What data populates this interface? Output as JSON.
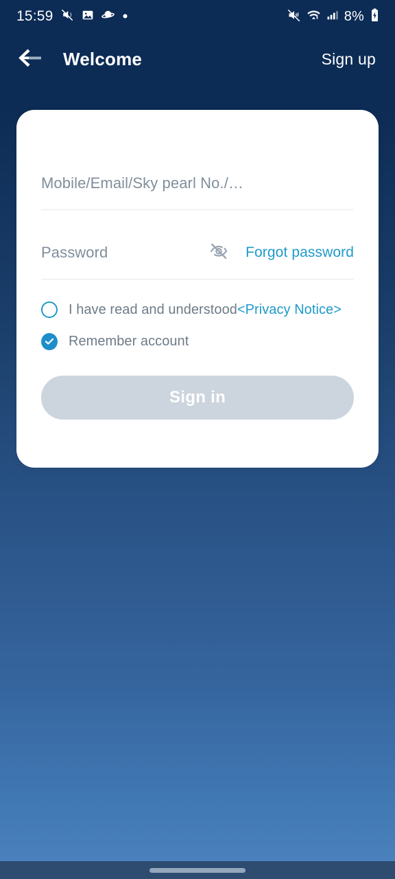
{
  "status_bar": {
    "time": "15:59",
    "left_icons": [
      "mute-slash-icon",
      "image-icon",
      "saturn-icon",
      "dot-icon"
    ],
    "right_icons": [
      "volume-mute-icon",
      "wifi-icon",
      "cellular-signal-icon"
    ],
    "battery_percent": "8%",
    "battery_icon": "battery-charging-icon",
    "background_color": "#0c2b55",
    "text_color": "#ffffff"
  },
  "header": {
    "back_icon": "arrow-left-icon",
    "title": "Welcome",
    "signup_label": "Sign up"
  },
  "card": {
    "account_field": {
      "placeholder": "Mobile/Email/Sky pearl No./…",
      "value": ""
    },
    "password_field": {
      "placeholder": "Password",
      "value": "",
      "visibility_icon": "eye-off-icon",
      "forgot_label": "Forgot password"
    },
    "checkboxes": [
      {
        "name": "privacy-notice",
        "checked": false,
        "label": "I have read and understood",
        "link_label": "<Privacy Notice>"
      },
      {
        "name": "remember-account",
        "checked": true,
        "label": "Remember account"
      }
    ],
    "signin_button": {
      "label": "Sign in",
      "enabled": false
    }
  },
  "colors": {
    "accent": "#1e9ac9",
    "card_background": "#ffffff",
    "page_gradient_top": "#0c2b55",
    "page_gradient_bottom": "#4a81bd",
    "button_disabled": "#ccd5dd",
    "navbar": "#2d4c70"
  },
  "navbar": {
    "handle": "gesture-pill"
  }
}
